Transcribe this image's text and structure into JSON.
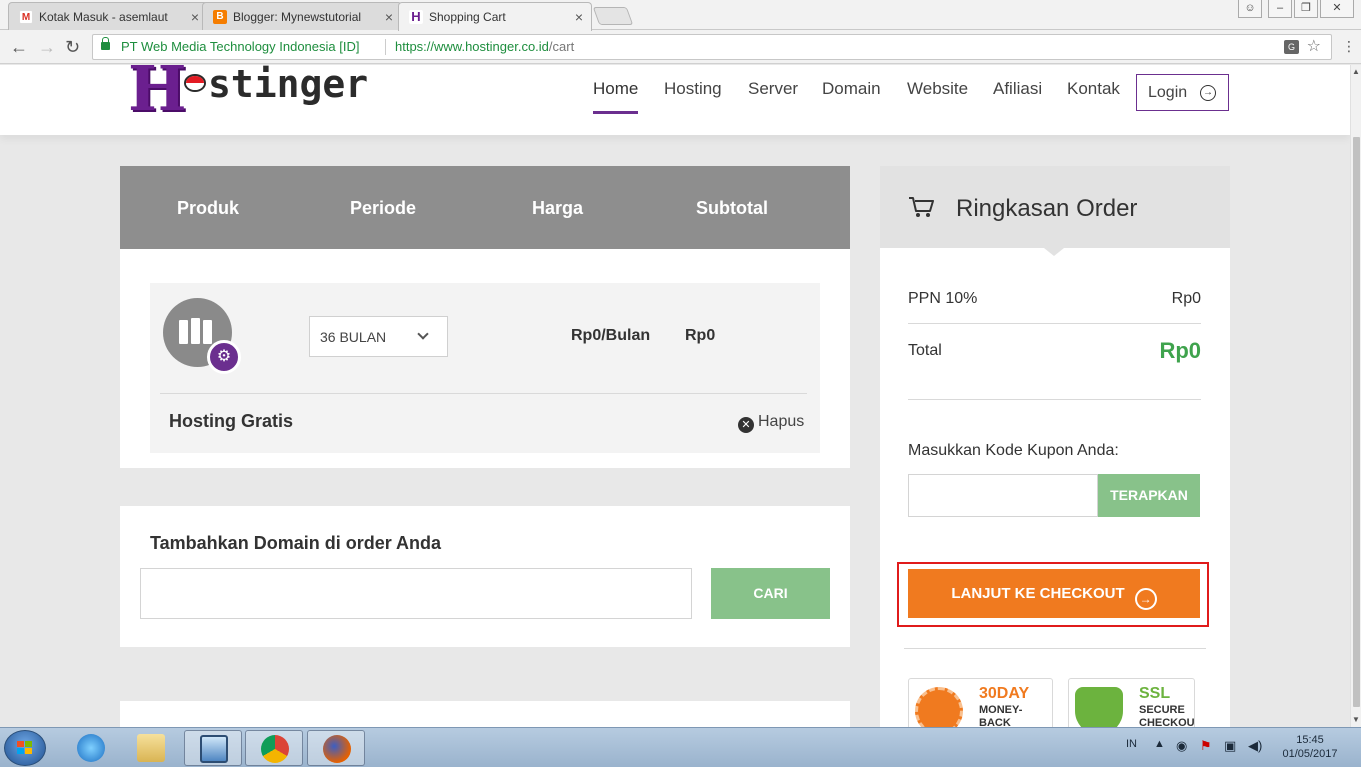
{
  "browser": {
    "tabs": [
      {
        "title": "Kotak Masuk - asemlaut",
        "icon": "gmail-icon",
        "color": "#d93025",
        "glyph": "M"
      },
      {
        "title": "Blogger: Mynewstutorial",
        "icon": "blogger-icon",
        "color": "#f57d00",
        "glyph": "B"
      },
      {
        "title": "Shopping Cart",
        "icon": "hostinger-favicon",
        "color": "#6b1f8f",
        "glyph": "H"
      }
    ],
    "secure_label": "PT Web Media Technology Indonesia [ID]",
    "url_host": "https://www.hostinger.co.id",
    "url_path": "/cart"
  },
  "header": {
    "logo_h": "H",
    "logo_text": "stinger",
    "nav": [
      "Home",
      "Hosting",
      "Server",
      "Domain",
      "Website",
      "Afiliasi",
      "Kontak"
    ],
    "active_nav": "Home",
    "login_label": "Login"
  },
  "cart": {
    "columns": [
      "Produk",
      "Periode",
      "Harga",
      "Subtotal"
    ],
    "item": {
      "period": "36 BULAN",
      "price": "Rp0/Bulan",
      "subtotal": "Rp0",
      "name": "Hosting Gratis",
      "remove_label": "Hapus"
    }
  },
  "domain": {
    "title": "Tambahkan Domain di order Anda",
    "input_value": "",
    "search_label": "CARI"
  },
  "summary": {
    "title": "Ringkasan Order",
    "tax_label": "PPN 10%",
    "tax_value": "Rp0",
    "total_label": "Total",
    "total_value": "Rp0",
    "coupon_label": "Masukkan Kode Kupon Anda:",
    "coupon_value": "",
    "apply_label": "TERAPKAN",
    "checkout_label": "LANJUT KE CHECKOUT",
    "badges": [
      {
        "top": "30DAY",
        "lines": "MONEY-BACK GUARANTEE",
        "color": "#f07a1f"
      },
      {
        "top": "SSL",
        "lines": "SECURE CHECKOUT",
        "color": "#6cb33e"
      }
    ]
  },
  "taskbar": {
    "lang": "IN",
    "time": "15:45",
    "date": "01/05/2017",
    "apps": [
      "internet-explorer-icon",
      "file-explorer-icon",
      "remote-desktop-icon",
      "chrome-icon",
      "firefox-icon"
    ]
  },
  "colors": {
    "brand_purple": "#6b2f8f",
    "checkout_orange": "#f07a1f",
    "button_green": "#88c28a",
    "total_green": "#3fa34d",
    "highlight_red": "#e01b1b"
  }
}
